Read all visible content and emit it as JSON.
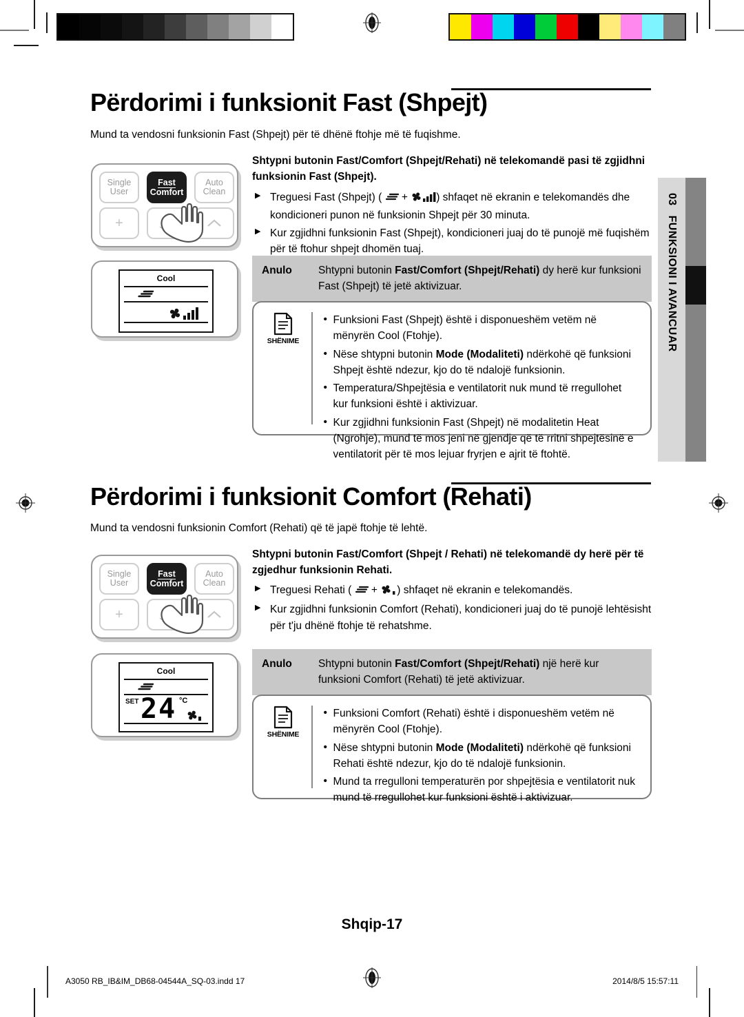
{
  "print_marks": {
    "grayscale_swatches": [
      "#000000",
      "#050505",
      "#0b0b0b",
      "#141414",
      "#232323",
      "#3d3d3d",
      "#5e5e5e",
      "#808080",
      "#a3a3a3",
      "#d0d0d0",
      "#ffffff"
    ],
    "color_swatches": [
      "#ffe800",
      "#ee00ee",
      "#00d5f0",
      "#0000d8",
      "#00cc3a",
      "#ee0000",
      "#000000",
      "#ffeb7a",
      "#ff88ee",
      "#7df4ff",
      "#808080"
    ]
  },
  "sidetab": {
    "chapter_number": "03",
    "chapter_title": "FUNKSIONI I AVANCUAR"
  },
  "sections": [
    {
      "heading": "Përdorimi i funksionit Fast (Shpejt)",
      "lead": "Mund ta vendosni funksionin Fast (Shpejt) për të dhënë ftohje më të fuqishme.",
      "remote": {
        "buttons_top": [
          {
            "line1": "Single",
            "line2": "User",
            "state": "normal"
          },
          {
            "line1": "Fast",
            "line2": "Comfort",
            "state": "pressed"
          },
          {
            "line1": "Auto",
            "line2": "Clean",
            "state": "normal"
          }
        ],
        "buttons_bottom": [
          {
            "icon": "plus-icon",
            "glyph": "+"
          },
          {
            "icon": "fan-swing-icon",
            "glyph": "≶"
          },
          {
            "icon": "chevron-up-icon",
            "glyph": "︿"
          }
        ],
        "hand_icon": "pointing-hand-icon"
      },
      "lcd": {
        "mode": "Cool",
        "swing_icon": "airflow-icon",
        "fan_icon": "fan-icon",
        "fan_level_bars": 4,
        "temperature": "",
        "set_label": "",
        "unit": ""
      },
      "instruction": {
        "pre": "Shtypni butonin ",
        "bold": "Fast/Comfort (Shpejt/Rehati)",
        "post": " në telekomandë pasi të zgjidhni funksionin Fast (Shpejt)."
      },
      "bullets": [
        "Treguesi Fast (Shpejt) (  +  ) shfaqet në ekranin e telekomandës dhe kondicioneri punon në funksionin Shpejt për 30 minuta.",
        "Kur zgjidhni funksionin Fast (Shpejt), kondicioneri juaj do të punojë më fuqishëm për të ftohur shpejt dhomën tuaj."
      ],
      "cancel": {
        "label": "Anulo",
        "pre": "Shtypni butonin ",
        "bold": "Fast/Comfort (Shpejt/Rehati)",
        "post": " dy herë kur funksioni Fast (Shpejt) të jetë aktivizuar."
      },
      "note": {
        "icon_caption": "SHËNIME",
        "items": [
          {
            "pre": "Funksioni Fast (Shpejt) është i disponueshëm vetëm në mënyrën Cool (Ftohje).",
            "bold": "",
            "post": ""
          },
          {
            "pre": "Nëse shtypni butonin ",
            "bold": "Mode (Modaliteti)",
            "post": " ndërkohë që funksioni Shpejt është ndezur, kjo do të ndalojë funksionin."
          },
          {
            "pre": "Temperatura/Shpejtësia e ventilatorit nuk mund të rregullohet kur funksioni është i aktivizuar.",
            "bold": "",
            "post": ""
          },
          {
            "pre": "Kur zgjidhni funksionin Fast (Shpejt) në modalitetin Heat (Ngrohje), mund të mos jeni në gjendje që të rritni shpejtësinë e ventilatorit për të mos lejuar fryrjen e ajrit të ftohtë.",
            "bold": "",
            "post": ""
          }
        ]
      }
    },
    {
      "heading": "Përdorimi i funksionit Comfort (Rehati)",
      "lead": "Mund ta vendosni funksionin Comfort (Rehati) që të japë ftohje të lehtë.",
      "remote": {
        "buttons_top": [
          {
            "line1": "Single",
            "line2": "User",
            "state": "normal"
          },
          {
            "line1": "Fast",
            "line2": "Comfort",
            "state": "pressed"
          },
          {
            "line1": "Auto",
            "line2": "Clean",
            "state": "normal"
          }
        ],
        "buttons_bottom": [
          {
            "icon": "plus-icon",
            "glyph": "+"
          },
          {
            "icon": "fan-swing-icon",
            "glyph": "≶"
          },
          {
            "icon": "chevron-up-icon",
            "glyph": "︿"
          }
        ],
        "hand_icon": "pointing-hand-icon"
      },
      "lcd": {
        "mode": "Cool",
        "swing_icon": "airflow-icon",
        "fan_icon": "fan-icon",
        "fan_level_bars": 1,
        "temperature": "24",
        "set_label": "SET",
        "unit": "°C"
      },
      "instruction": {
        "pre": "Shtypni butonin ",
        "bold": "Fast/Comfort (Shpejt / Rehati)",
        "post": " në telekomandë dy herë për të zgjedhur funksionin Rehati."
      },
      "bullets": [
        "Treguesi Rehati (  +  ) shfaqet në ekranin e telekomandës.",
        "Kur zgjidhni funksionin Comfort (Rehati), kondicioneri juaj do të punojë lehtësisht për t'ju dhënë ftohje të rehatshme."
      ],
      "cancel": {
        "label": "Anulo",
        "pre": "Shtypni butonin ",
        "bold": "Fast/Comfort (Shpejt/Rehati)",
        "post": " një herë kur funksioni Comfort (Rehati) të jetë aktivizuar."
      },
      "note": {
        "icon_caption": "SHËNIME",
        "items": [
          {
            "pre": "Funksioni Comfort (Rehati) është i disponueshëm vetëm në mënyrën Cool (Ftohje).",
            "bold": "",
            "post": ""
          },
          {
            "pre": "Nëse shtypni butonin ",
            "bold": "Mode (Modaliteti)",
            "post": " ndërkohë që funksioni Rehati është ndezur, kjo do të ndalojë funksionin."
          },
          {
            "pre": "Mund ta rregulloni temperaturën por shpejtësia e ventilatorit nuk mund të rregullohet kur funksioni është i aktivizuar.",
            "bold": "",
            "post": ""
          }
        ]
      }
    }
  ],
  "page_marker": "Shqip-17",
  "footer": {
    "file": "A3050 RB_IB&IM_DB68-04544A_SQ-03.indd   17",
    "timestamp": "2014/8/5   15:57:11"
  }
}
